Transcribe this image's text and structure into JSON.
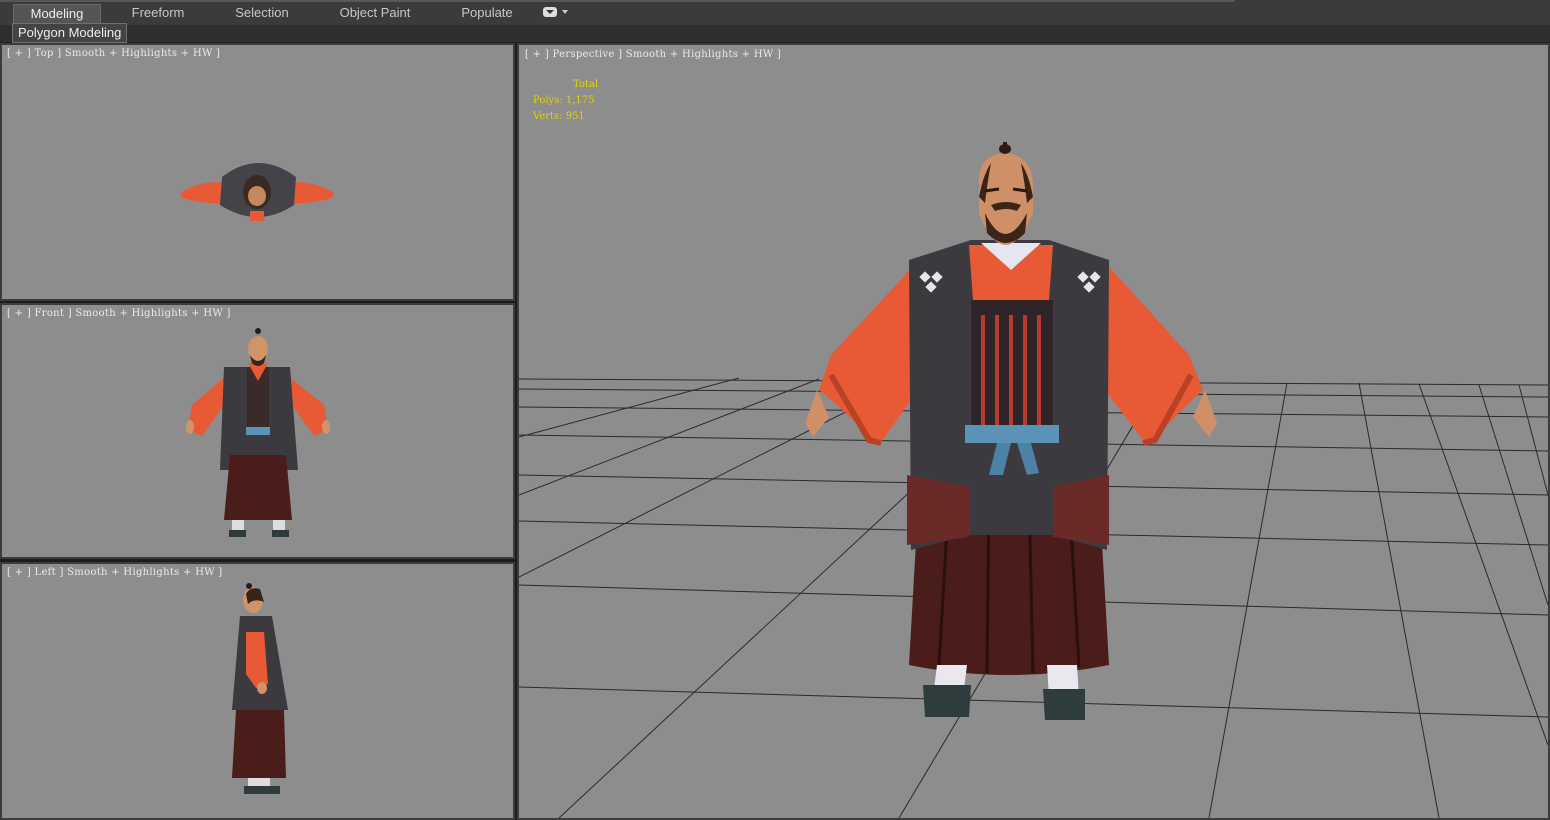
{
  "ribbon": {
    "tabs": [
      {
        "label": "Modeling",
        "active": true
      },
      {
        "label": "Freeform",
        "active": false
      },
      {
        "label": "Selection",
        "active": false
      },
      {
        "label": "Object Paint",
        "active": false
      },
      {
        "label": "Populate",
        "active": false
      }
    ],
    "panel_label": "Polygon Modeling"
  },
  "viewports": {
    "top": {
      "label": "[ + ] Top ] Smooth + Highlights + HW ]"
    },
    "front": {
      "label": "[ + ] Front ] Smooth + Highlights + HW ]"
    },
    "left": {
      "label": "[ + ] Left ] Smooth + Highlights + HW ]"
    },
    "perspective": {
      "label": "[ + ] Perspective ] Smooth + Highlights + HW ]",
      "stats": {
        "total_label": "Total",
        "polys": "Polys: 1,175",
        "verts": "Verts: 951"
      }
    }
  },
  "colors": {
    "viewport_bg": "#8d8d8d",
    "stats_text": "#e3d400",
    "sleeve": "#e85a35",
    "vest": "#3d3a3f",
    "hakama": "#4a1c1a",
    "sash": "#5b93b6"
  }
}
